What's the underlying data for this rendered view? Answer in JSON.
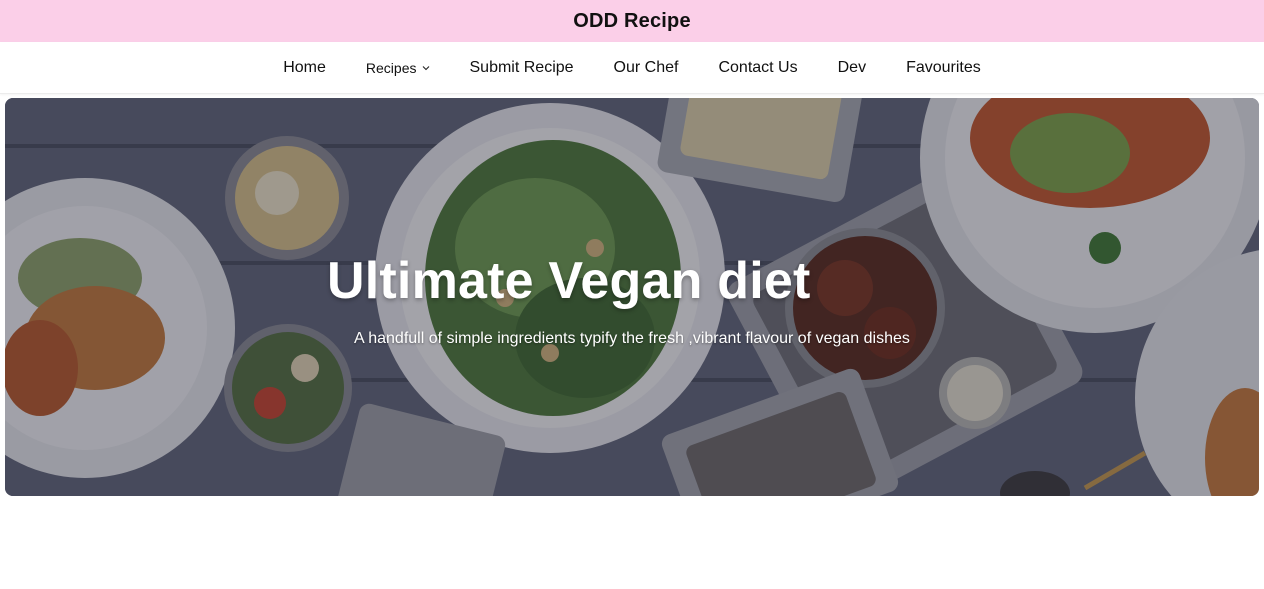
{
  "header": {
    "brand": "ODD Recipe"
  },
  "nav": {
    "items": [
      {
        "label": "Home"
      },
      {
        "label": "Recipes"
      },
      {
        "label": "Submit Recipe"
      },
      {
        "label": "Our Chef"
      },
      {
        "label": "Contact Us"
      },
      {
        "label": "Dev"
      },
      {
        "label": "Favourites"
      }
    ],
    "dropdown_icon": "chevron-down-icon"
  },
  "hero": {
    "title": "Ultimate Vegan diet",
    "subtitle": "A handfull of simple ingredients typify the fresh ,vibrant flavour of vegan dishes"
  },
  "colors": {
    "topbar_bg": "#fbcfe8",
    "table_wood": "#5f6477",
    "hero_text": "#ffffff"
  }
}
